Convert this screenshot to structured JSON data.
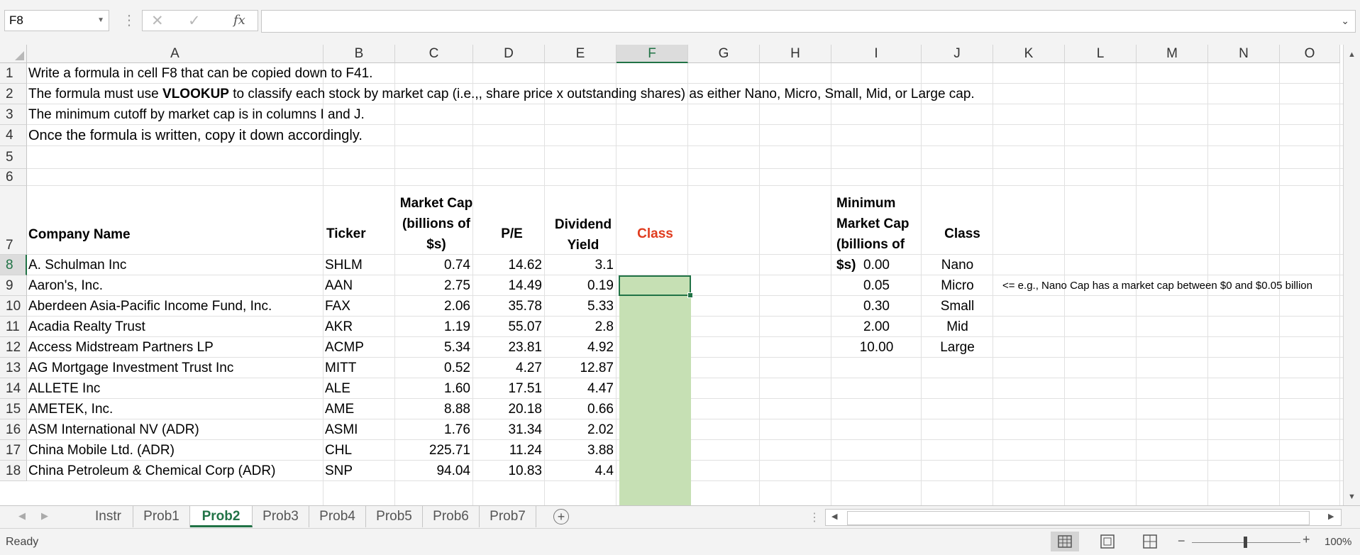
{
  "formula_bar": {
    "name_box": "F8",
    "formula": ""
  },
  "columns": [
    "A",
    "B",
    "C",
    "D",
    "E",
    "F",
    "G",
    "H",
    "I",
    "J",
    "K",
    "L",
    "M",
    "N",
    "O"
  ],
  "rows": [
    "1",
    "2",
    "3",
    "4",
    "5",
    "6",
    "7",
    "8",
    "9",
    "10",
    "11",
    "12",
    "13",
    "14",
    "15",
    "16",
    "17",
    "18"
  ],
  "instructions": {
    "line1": "Write a formula in cell F8 that can be copied down to F41.",
    "line2_pre": "The formula must use ",
    "line2_bold": "VLOOKUP",
    "line2_post": " to classify each stock by market cap (i.e.,, share price x outstanding shares) as either Nano, Micro, Small, Mid, or Large cap.",
    "line3": "The minimum cutoff by market cap is in columns I and J.",
    "line4": "Once the formula is written, copy it down accordingly."
  },
  "table": {
    "headers": {
      "company": "Company Name",
      "ticker": "Ticker",
      "market_cap": "Market Cap (billions of $s)",
      "pe": "P/E",
      "dividend": "Dividend Yield",
      "class": "Class"
    },
    "rows": [
      {
        "company": "A. Schulman Inc",
        "ticker": "SHLM",
        "cap": "0.74",
        "pe": "14.62",
        "div": "3.1"
      },
      {
        "company": "Aaron's, Inc.",
        "ticker": "AAN",
        "cap": "2.75",
        "pe": "14.49",
        "div": "0.19"
      },
      {
        "company": "Aberdeen Asia-Pacific Income Fund, Inc.",
        "ticker": "FAX",
        "cap": "2.06",
        "pe": "35.78",
        "div": "5.33"
      },
      {
        "company": "Acadia Realty Trust",
        "ticker": "AKR",
        "cap": "1.19",
        "pe": "55.07",
        "div": "2.8"
      },
      {
        "company": "Access Midstream Partners LP",
        "ticker": "ACMP",
        "cap": "5.34",
        "pe": "23.81",
        "div": "4.92"
      },
      {
        "company": "AG Mortgage Investment Trust Inc",
        "ticker": "MITT",
        "cap": "0.52",
        "pe": "4.27",
        "div": "12.87"
      },
      {
        "company": "ALLETE Inc",
        "ticker": "ALE",
        "cap": "1.60",
        "pe": "17.51",
        "div": "4.47"
      },
      {
        "company": "AMETEK, Inc.",
        "ticker": "AME",
        "cap": "8.88",
        "pe": "20.18",
        "div": "0.66"
      },
      {
        "company": "ASM International NV (ADR)",
        "ticker": "ASMI",
        "cap": "1.76",
        "pe": "31.34",
        "div": "2.02"
      },
      {
        "company": "China Mobile Ltd. (ADR)",
        "ticker": "CHL",
        "cap": "225.71",
        "pe": "11.24",
        "div": "3.88"
      },
      {
        "company": "China Petroleum & Chemical Corp (ADR)",
        "ticker": "SNP",
        "cap": "94.04",
        "pe": "10.83",
        "div": "4.4"
      }
    ]
  },
  "lookup": {
    "header_min": "Minimum Market Cap (billions of $s)",
    "header_class": "Class",
    "rows": [
      {
        "min": "0.00",
        "class": "Nano"
      },
      {
        "min": "0.05",
        "class": "Micro"
      },
      {
        "min": "0.30",
        "class": "Small"
      },
      {
        "min": "2.00",
        "class": "Mid"
      },
      {
        "min": "10.00",
        "class": "Large"
      }
    ],
    "note": "<= e.g., Nano Cap has a market cap between $0 and $0.05 billion"
  },
  "tabs": [
    "Instr",
    "Prob1",
    "Prob2",
    "Prob3",
    "Prob4",
    "Prob5",
    "Prob6",
    "Prob7"
  ],
  "active_tab": "Prob2",
  "status": "Ready",
  "zoom": "100%",
  "colors": {
    "accent": "#217346",
    "class_fill": "#c6e0b4",
    "class_header": "#e03c1f"
  }
}
